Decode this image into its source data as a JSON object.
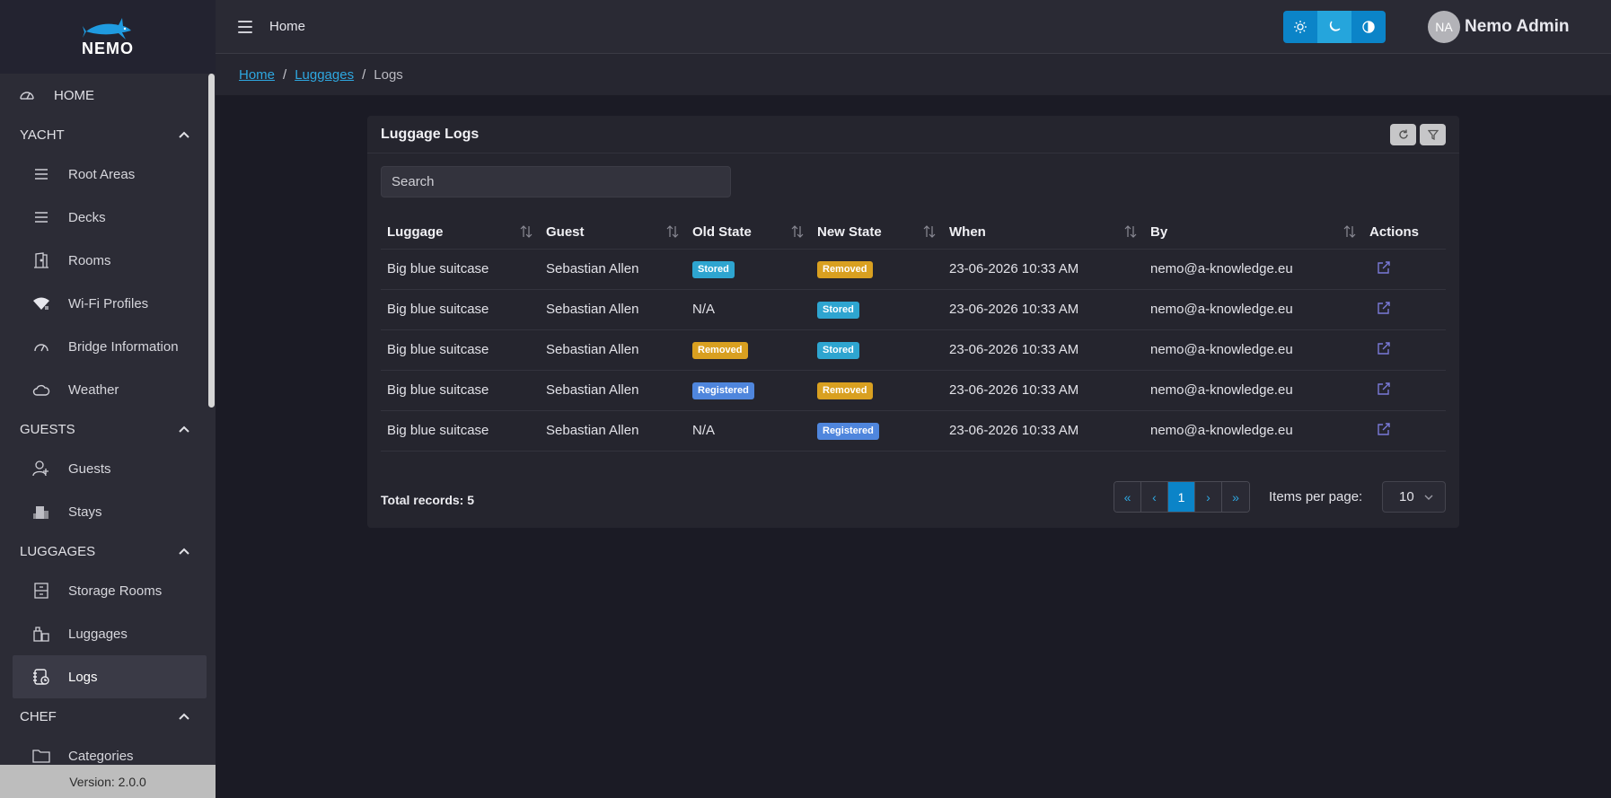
{
  "sidebar": {
    "logo_text": "NEMO",
    "home_label": "HOME",
    "sections": [
      {
        "label": "YACHT",
        "items": [
          {
            "label": "Root Areas",
            "icon": "list-icon"
          },
          {
            "label": "Decks",
            "icon": "list-icon"
          },
          {
            "label": "Rooms",
            "icon": "door-icon"
          },
          {
            "label": "Wi-Fi Profiles",
            "icon": "wifi-icon"
          },
          {
            "label": "Bridge Information",
            "icon": "gauge-icon"
          },
          {
            "label": "Weather",
            "icon": "cloud-icon"
          }
        ]
      },
      {
        "label": "GUESTS",
        "items": [
          {
            "label": "Guests",
            "icon": "user-add-icon"
          },
          {
            "label": "Stays",
            "icon": "hotel-icon"
          }
        ]
      },
      {
        "label": "LUGGAGES",
        "items": [
          {
            "label": "Storage Rooms",
            "icon": "storage-icon"
          },
          {
            "label": "Luggages",
            "icon": "luggage-icon"
          },
          {
            "label": "Logs",
            "icon": "log-icon"
          }
        ]
      },
      {
        "label": "CHEF",
        "items": [
          {
            "label": "Categories",
            "icon": "folder-icon"
          }
        ]
      }
    ],
    "version": "Version: 2.0.0"
  },
  "topbar": {
    "title": "Home",
    "user_initials": "NA",
    "user_name": "Nemo Admin"
  },
  "breadcrumb": {
    "home": "Home",
    "luggages": "Luggages",
    "current": "Logs"
  },
  "card": {
    "title": "Luggage Logs",
    "search_placeholder": "Search",
    "columns": [
      "Luggage",
      "Guest",
      "Old State",
      "New State",
      "When",
      "By",
      "Actions"
    ],
    "rows": [
      {
        "luggage": "Big blue suitcase",
        "guest": "Sebastian Allen",
        "old_state": "Stored",
        "new_state": "Removed",
        "when": "23-06-2026 10:33 AM",
        "by": "nemo@a-knowledge.eu"
      },
      {
        "luggage": "Big blue suitcase",
        "guest": "Sebastian Allen",
        "old_state": "N/A",
        "new_state": "Stored",
        "when": "23-06-2026 10:33 AM",
        "by": "nemo@a-knowledge.eu"
      },
      {
        "luggage": "Big blue suitcase",
        "guest": "Sebastian Allen",
        "old_state": "Removed",
        "new_state": "Stored",
        "when": "23-06-2026 10:33 AM",
        "by": "nemo@a-knowledge.eu"
      },
      {
        "luggage": "Big blue suitcase",
        "guest": "Sebastian Allen",
        "old_state": "Registered",
        "new_state": "Removed",
        "when": "23-06-2026 10:33 AM",
        "by": "nemo@a-knowledge.eu"
      },
      {
        "luggage": "Big blue suitcase",
        "guest": "Sebastian Allen",
        "old_state": "N/A",
        "new_state": "Registered",
        "when": "23-06-2026 10:33 AM",
        "by": "nemo@a-knowledge.eu"
      }
    ],
    "total_records": "Total records: 5",
    "pager": {
      "first": "«",
      "prev": "‹",
      "current": "1",
      "next": "›",
      "last": "»"
    },
    "items_per_page_label": "Items per page:",
    "items_per_page_value": "10"
  },
  "colors": {
    "accent": "#0b84c8",
    "link": "#2ea7e0",
    "stored": "#2ea5d0",
    "removed": "#d9a020",
    "registered": "#4f86dd"
  }
}
